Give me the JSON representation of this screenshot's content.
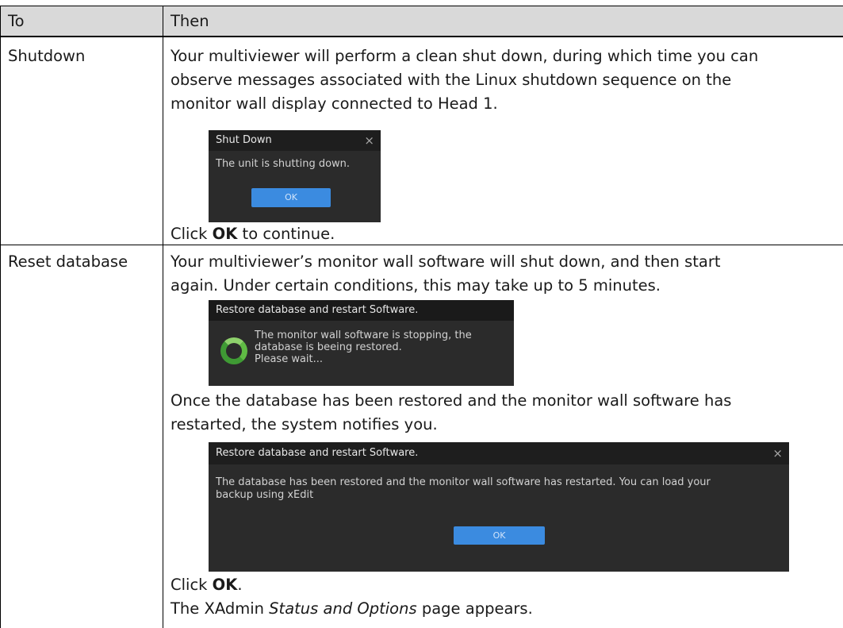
{
  "table": {
    "header": {
      "col_to": "To",
      "col_then": "Then"
    },
    "rows": [
      {
        "action": "Shutdown",
        "lines": [
          "Your multiviewer will perform a clean shut down, during which time you can",
          "observe messages associated with the Linux shutdown sequence on the",
          "monitor wall display connected to Head 1."
        ],
        "dialog": {
          "title": "Shut Down",
          "close_glyph": "×",
          "message": "The unit is shutting down.",
          "ok_label": "OK"
        },
        "after_prefix": "Click ",
        "after_bold": "OK",
        "after_suffix": " to continue."
      },
      {
        "action": "Reset database",
        "lines": [
          "Your multiviewer’s monitor wall software will shut down, and then start",
          "again. Under certain conditions, this may take up to 5 minutes."
        ],
        "dialog_progress": {
          "title": "Restore database and restart Software.",
          "message_lines": [
            "The monitor wall software is stopping, the",
            "database is beeing restored.",
            "Please wait..."
          ]
        },
        "middle_lines": [
          "Once the database has been restored and the monitor wall software has",
          "restarted, the system notifies you."
        ],
        "dialog_done": {
          "title": "Restore database and restart Software.",
          "close_glyph": "×",
          "message_lines": [
            "The database has been restored and the monitor wall software has restarted. You can load your",
            "backup using xEdit"
          ],
          "ok_label": "OK"
        },
        "click_prefix": "Click ",
        "click_bold": "OK",
        "click_suffix": ".",
        "final_prefix": "The XAdmin ",
        "final_italic": "Status and Options",
        "final_suffix": " page appears."
      }
    ]
  },
  "colors": {
    "header_bg": "#d9d9d9",
    "dialog_bg": "#2b2b2b",
    "dialog_title_bg": "#1e1e1e",
    "ok_button": "#3b8be0",
    "spinner_green": "#5fba44"
  }
}
